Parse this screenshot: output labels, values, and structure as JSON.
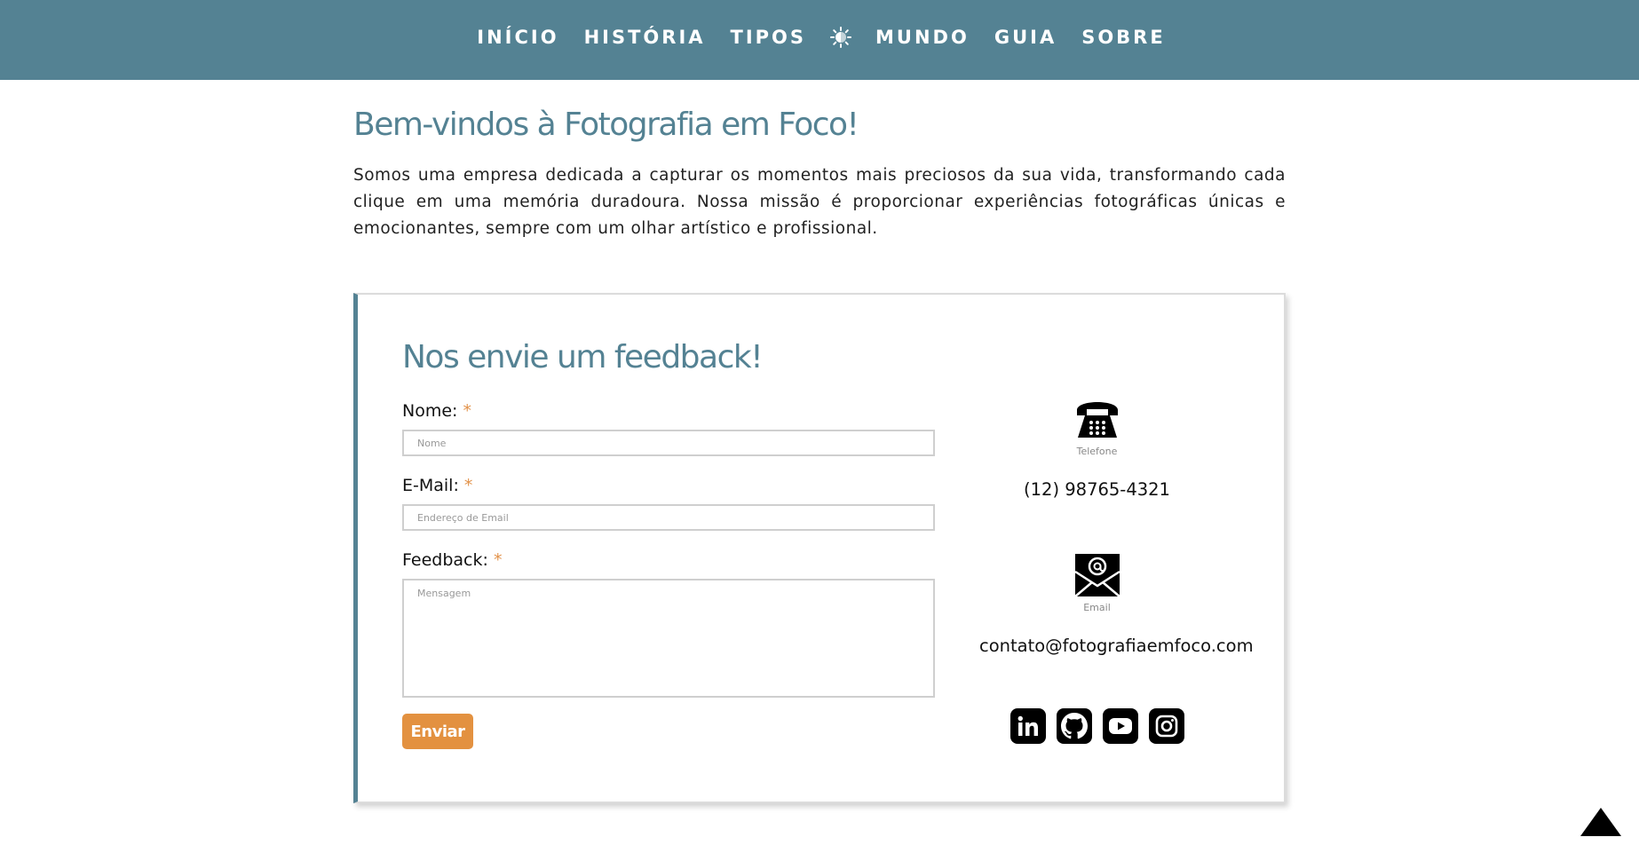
{
  "nav": {
    "items": [
      {
        "label": "INÍCIO"
      },
      {
        "label": "HISTÓRIA"
      },
      {
        "label": "TIPOS"
      },
      {
        "label": "MUNDO"
      },
      {
        "label": "GUIA"
      },
      {
        "label": "SOBRE"
      }
    ],
    "theme_icon": "sun-icon"
  },
  "intro": {
    "title": "Bem-vindos à Fotografia em Foco!",
    "text": "Somos uma empresa dedicada a capturar os momentos mais preciosos da sua vida, transformando cada clique em uma memória duradoura. Nossa missão é proporcionar experiências fotográficas únicas e emocionantes, sempre com um olhar artístico e profissional."
  },
  "form": {
    "title": "Nos envie um feedback!",
    "required_mark": "*",
    "name_label": "Nome:",
    "name_placeholder": "Nome",
    "email_label": "E-Mail:",
    "email_placeholder": "Endereço de Email",
    "feedback_label": "Feedback:",
    "feedback_placeholder": "Mensagem",
    "submit_label": "Enviar"
  },
  "contact": {
    "phone_caption": "Telefone",
    "phone": "(12) 98765-4321",
    "email_caption": "Email",
    "email": "contato@fotografiaemfoco.com",
    "socials": [
      "linkedin-icon",
      "github-icon",
      "youtube-icon",
      "instagram-icon"
    ]
  },
  "colors": {
    "brand": "#548293",
    "accent": "#e39140"
  },
  "back_to_top_icon": "triangle-up-icon"
}
